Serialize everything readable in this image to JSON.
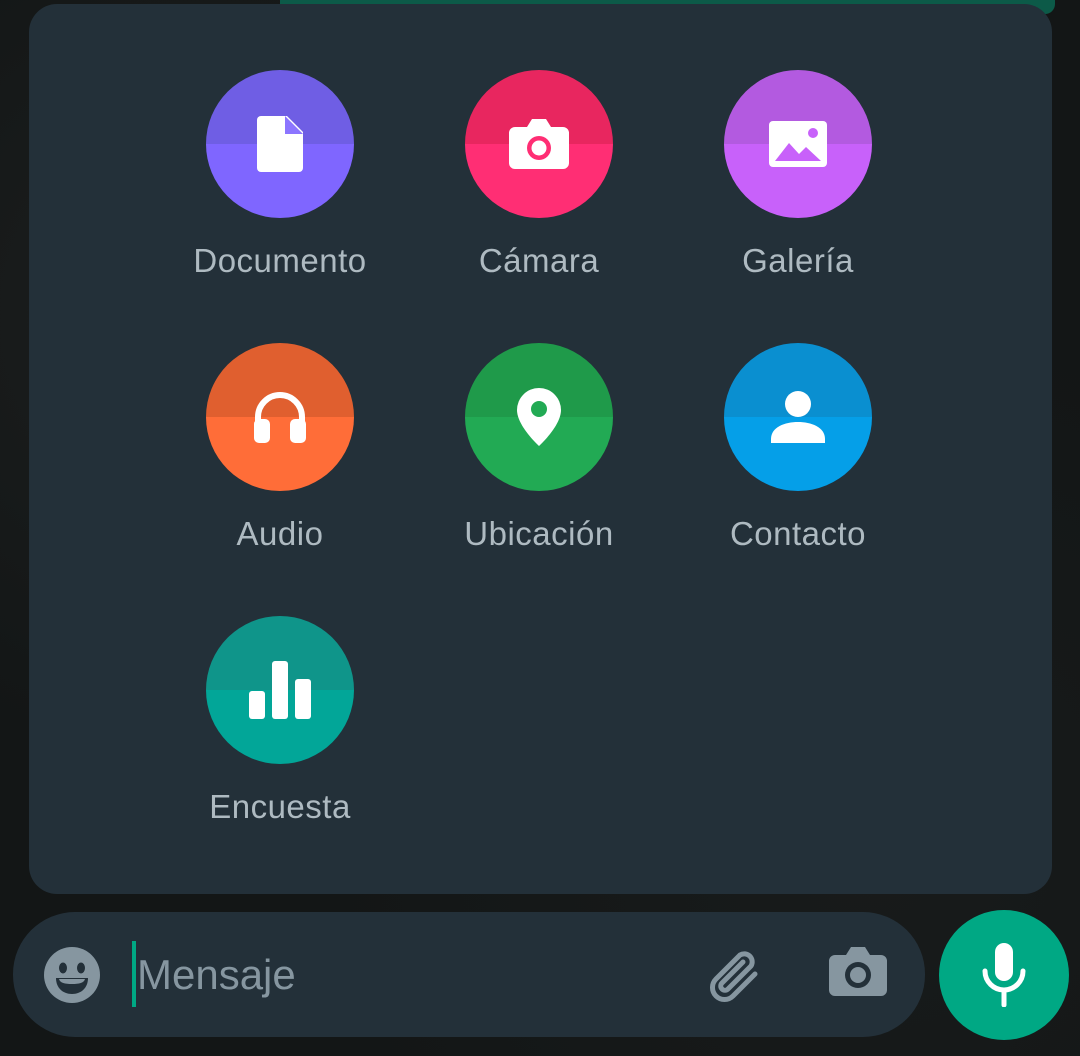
{
  "attachments": [
    {
      "label": "Documento",
      "icon": "document-icon",
      "color_top": "#6f5ee4",
      "color_bottom": "#7f66ff"
    },
    {
      "label": "Cámara",
      "icon": "camera-icon",
      "color_top": "#e8265f",
      "color_bottom": "#ff2e74"
    },
    {
      "label": "Galería",
      "icon": "gallery-icon",
      "color_top": "#b35ae0",
      "color_bottom": "#c861fa"
    },
    {
      "label": "Audio",
      "icon": "headphones-icon",
      "color_top": "#e05f2f",
      "color_bottom": "#ff6d38"
    },
    {
      "label": "Ubicación",
      "icon": "location-pin-icon",
      "color_top": "#1f9a4a",
      "color_bottom": "#22aa54"
    },
    {
      "label": "Contacto",
      "icon": "contact-icon",
      "color_top": "#0a8fd0",
      "color_bottom": "#059fe8"
    },
    {
      "label": "Encuesta",
      "icon": "poll-icon",
      "color_top": "#0f958a",
      "color_bottom": "#02a698"
    }
  ],
  "composer": {
    "placeholder": "Mensaje",
    "value": ""
  },
  "colors": {
    "accent": "#00a884",
    "panel": "#233039",
    "label": "#aebac1"
  }
}
